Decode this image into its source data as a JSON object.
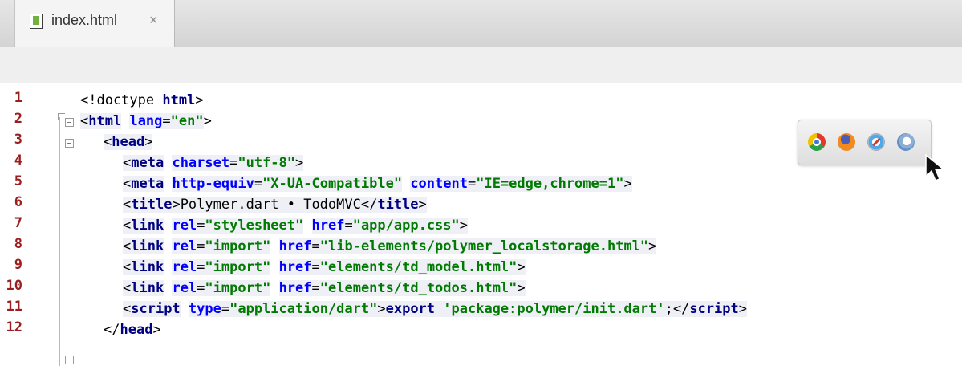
{
  "editor": {
    "tab": {
      "file_name": "index.html",
      "close_glyph": "×",
      "icon": "html-file-icon"
    }
  },
  "line_numbers": [
    "1",
    "2",
    "3",
    "4",
    "5",
    "6",
    "7",
    "8",
    "9",
    "10",
    "11",
    "12"
  ],
  "code": {
    "l1": {
      "a": "<!doctype ",
      "b": "html",
      "c": ">"
    },
    "l2": {
      "a": "<",
      "b": "html",
      "c": "lang",
      "d": "=",
      "e": "\"en\"",
      "f": ">"
    },
    "l3": {
      "a": "<",
      "b": "head",
      "c": ">"
    },
    "l4": {
      "a": "<",
      "b": "meta",
      "c": "charset",
      "d": "=",
      "e": "\"utf-8\"",
      "f": ">"
    },
    "l5": {
      "a": "<",
      "b": "meta",
      "c": "http-equiv",
      "d": "=",
      "e": "\"X-UA-Compatible\"",
      "f": "content",
      "g": "=",
      "h": "\"IE=edge,chrome=1\"",
      "i": ">"
    },
    "l6": {
      "a": "<",
      "b": "title",
      "c": ">",
      "d": "Polymer.dart • TodoMVC",
      "e": "</",
      "f": "title",
      "g": ">"
    },
    "l7": {
      "a": "<",
      "b": "link",
      "c": "rel",
      "d": "=",
      "e": "\"stylesheet\"",
      "f": "href",
      "g": "=",
      "h": "\"app/app.css\"",
      "i": ">"
    },
    "l8": {
      "a": "<",
      "b": "link",
      "c": "rel",
      "d": "=",
      "e": "\"import\"",
      "f": "href",
      "g": "=",
      "h": "\"lib-elements/polymer_localstorage.html\"",
      "i": ">"
    },
    "l9": {
      "a": "<",
      "b": "link",
      "c": "rel",
      "d": "=",
      "e": "\"import\"",
      "f": "href",
      "g": "=",
      "h": "\"elements/td_model.html\"",
      "i": ">"
    },
    "l10": {
      "a": "<",
      "b": "link",
      "c": "rel",
      "d": "=",
      "e": "\"import\"",
      "f": "href",
      "g": "=",
      "h": "\"elements/td_todos.html\"",
      "i": ">"
    },
    "l11": {
      "a": "<",
      "b": "script",
      "c": "type",
      "d": "=",
      "e": "\"application/dart\"",
      "f": ">",
      "g": "export",
      "h": " 'package:polymer/init.dart'",
      "i": ";",
      "j": "</",
      "k": "script",
      "l": ">"
    },
    "l12": {
      "a": "</",
      "b": "head",
      "c": ">"
    }
  },
  "browser_icons": [
    "chrome-icon",
    "firefox-icon",
    "safari-icon",
    "opera-icon"
  ],
  "colors": {
    "line_number": "#9b1f1f",
    "tag": "#000080",
    "attribute": "#0000ff",
    "string": "#007a00",
    "highlight": "#eef0f6"
  }
}
